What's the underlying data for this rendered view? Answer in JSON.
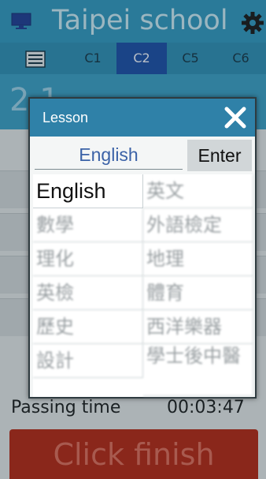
{
  "app": {
    "title": "Taipei school",
    "icons": {
      "monitor": "monitor-icon",
      "settings": "gear-icon",
      "list": "list-icon"
    }
  },
  "tabs": [
    {
      "label": "C1"
    },
    {
      "label": "C2",
      "selected": true
    },
    {
      "label": "C5"
    },
    {
      "label": "C6"
    }
  ],
  "background": {
    "date_partial": "2  1      ",
    "passing_label": "Passing time",
    "passing_time": "00:03:47",
    "finish_label": "Click finish"
  },
  "modal": {
    "title": "Lesson",
    "search_value": "English",
    "enter_label": "Enter",
    "lessons": [
      "English",
      "英文",
      "數學",
      "外語檢定",
      "理化",
      "地理",
      "英檢",
      "體育",
      "歷史",
      "西洋樂器",
      "設計",
      "學士後中醫"
    ]
  },
  "colors": {
    "header_blue": "#2f81a8",
    "accent_tab": "#1c4fa0",
    "finish_red": "#a42b1d",
    "search_text": "#3b62a7"
  }
}
